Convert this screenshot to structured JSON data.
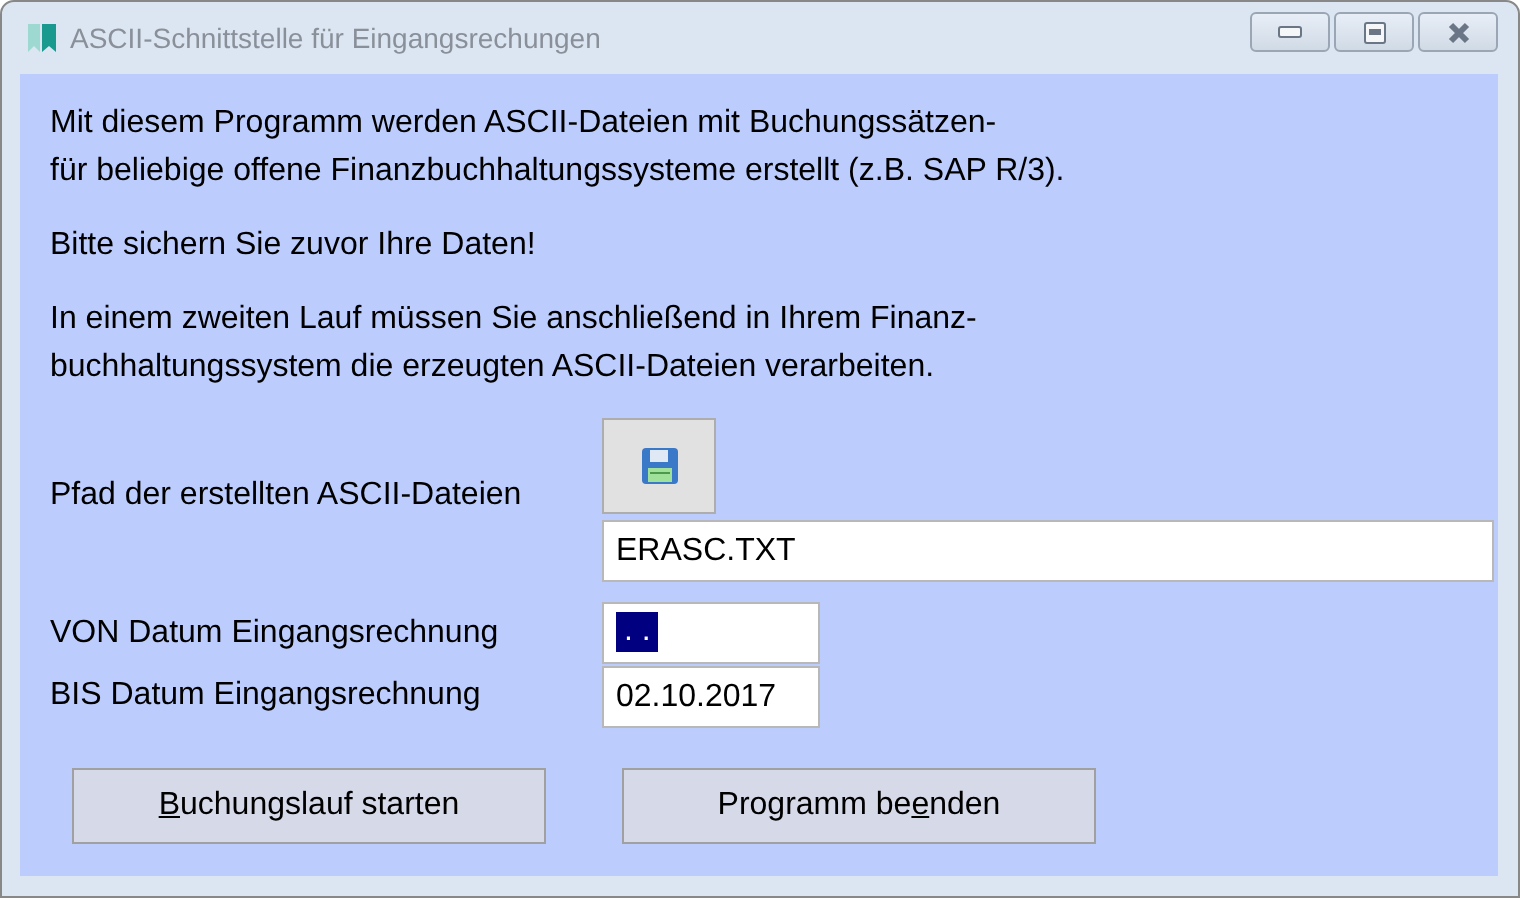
{
  "window": {
    "title": "ASCII-Schnittstelle für Eingangsrechungen"
  },
  "paragraphs": [
    [
      "Mit diesem Programm werden ASCII-Dateien mit Buchungssätzen-",
      "für beliebige offene Finanzbuchhaltungssysteme erstellt (z.B. SAP R/3)."
    ],
    [
      "Bitte sichern Sie zuvor Ihre Daten!"
    ],
    [
      "In einem zweiten Lauf müssen Sie anschließend in Ihrem Finanz-",
      "buchhaltungssystem die erzeugten ASCII-Dateien verarbeiten."
    ]
  ],
  "path": {
    "label": "Pfad der erstellten ASCII-Dateien",
    "value": "ERASC.TXT"
  },
  "dates": [
    {
      "label": "VON Datum Eingangsrechnung",
      "value": ". .",
      "selected": true
    },
    {
      "label": "BIS Datum Eingangsrechnung",
      "value": "02.10.2017",
      "selected": false
    }
  ],
  "buttons": [
    {
      "accesskey": "B",
      "after": "uchungslauf starten"
    },
    {
      "before": "Programm be",
      "accesskey": "e",
      "after": "nden"
    }
  ]
}
